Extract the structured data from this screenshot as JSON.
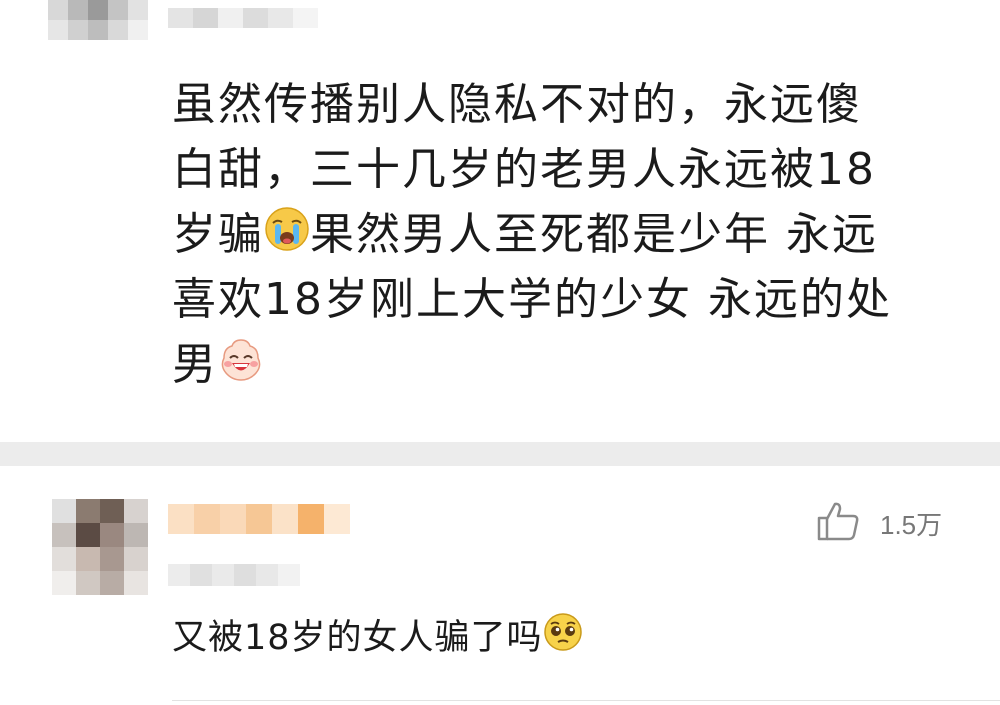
{
  "comment1": {
    "text_lines": [
      "虽然传播别人隐私不对的，永远傻",
      "白甜，三十几岁的老男人永远被18",
      "岁骗",
      "果然男人至死都是少年 永远",
      "喜欢18岁刚上大学的少女 永远的处",
      "男"
    ],
    "emojis": [
      "crying-face-emoji",
      "laughing-face-emoji"
    ]
  },
  "comment2": {
    "like_icon": "thumbs-up-icon",
    "like_count": "1.5万",
    "text": "又被18岁的女人骗了吗",
    "emoji": "pleading-face-emoji"
  },
  "colors": {
    "text": "#1b1b1b",
    "divider": "#ececec",
    "like_gray": "#777777",
    "username_orange": "#f5b26b"
  }
}
